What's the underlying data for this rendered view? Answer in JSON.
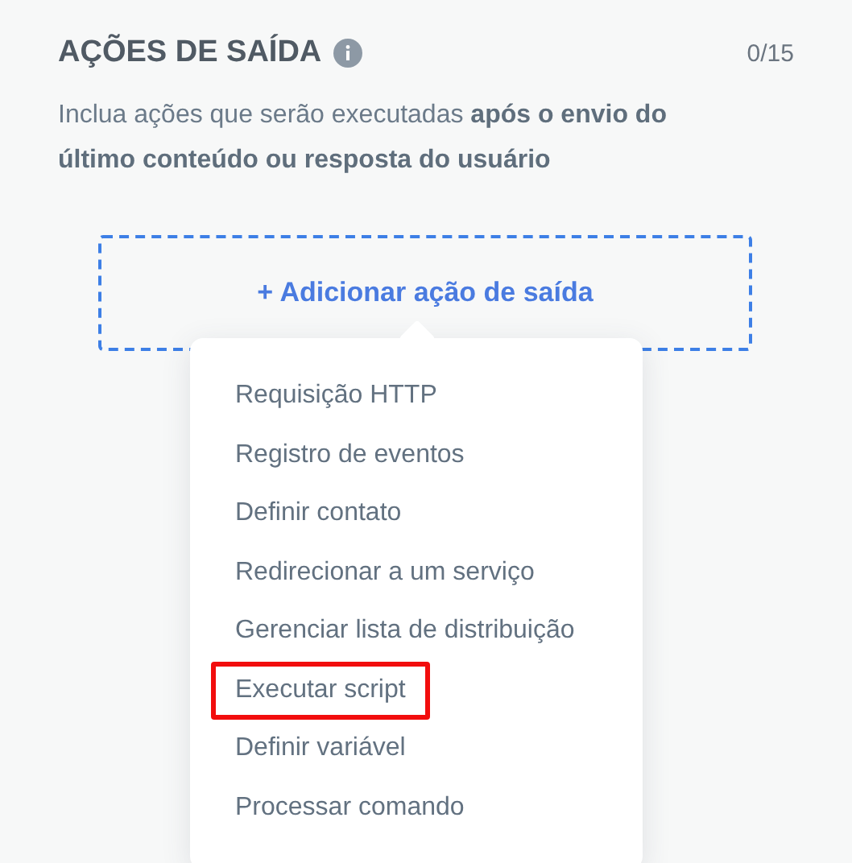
{
  "section": {
    "title": "AÇÕES DE SAÍDA",
    "counter": "0/15",
    "description": "Inclua ações que serão executadas **após o envio do último conteúdo ou resposta do usuário**"
  },
  "add_button": {
    "label": "+ Adicionar ação de saída"
  },
  "menu": {
    "items": [
      {
        "label": "Requisição HTTP",
        "highlighted": false
      },
      {
        "label": "Registro de eventos",
        "highlighted": false
      },
      {
        "label": "Definir contato",
        "highlighted": false
      },
      {
        "label": "Redirecionar a um serviço",
        "highlighted": false
      },
      {
        "label": "Gerenciar lista de distribuição",
        "highlighted": false
      },
      {
        "label": "Executar script",
        "highlighted": true
      },
      {
        "label": "Definir variável",
        "highlighted": false
      },
      {
        "label": "Processar comando",
        "highlighted": false
      }
    ]
  }
}
